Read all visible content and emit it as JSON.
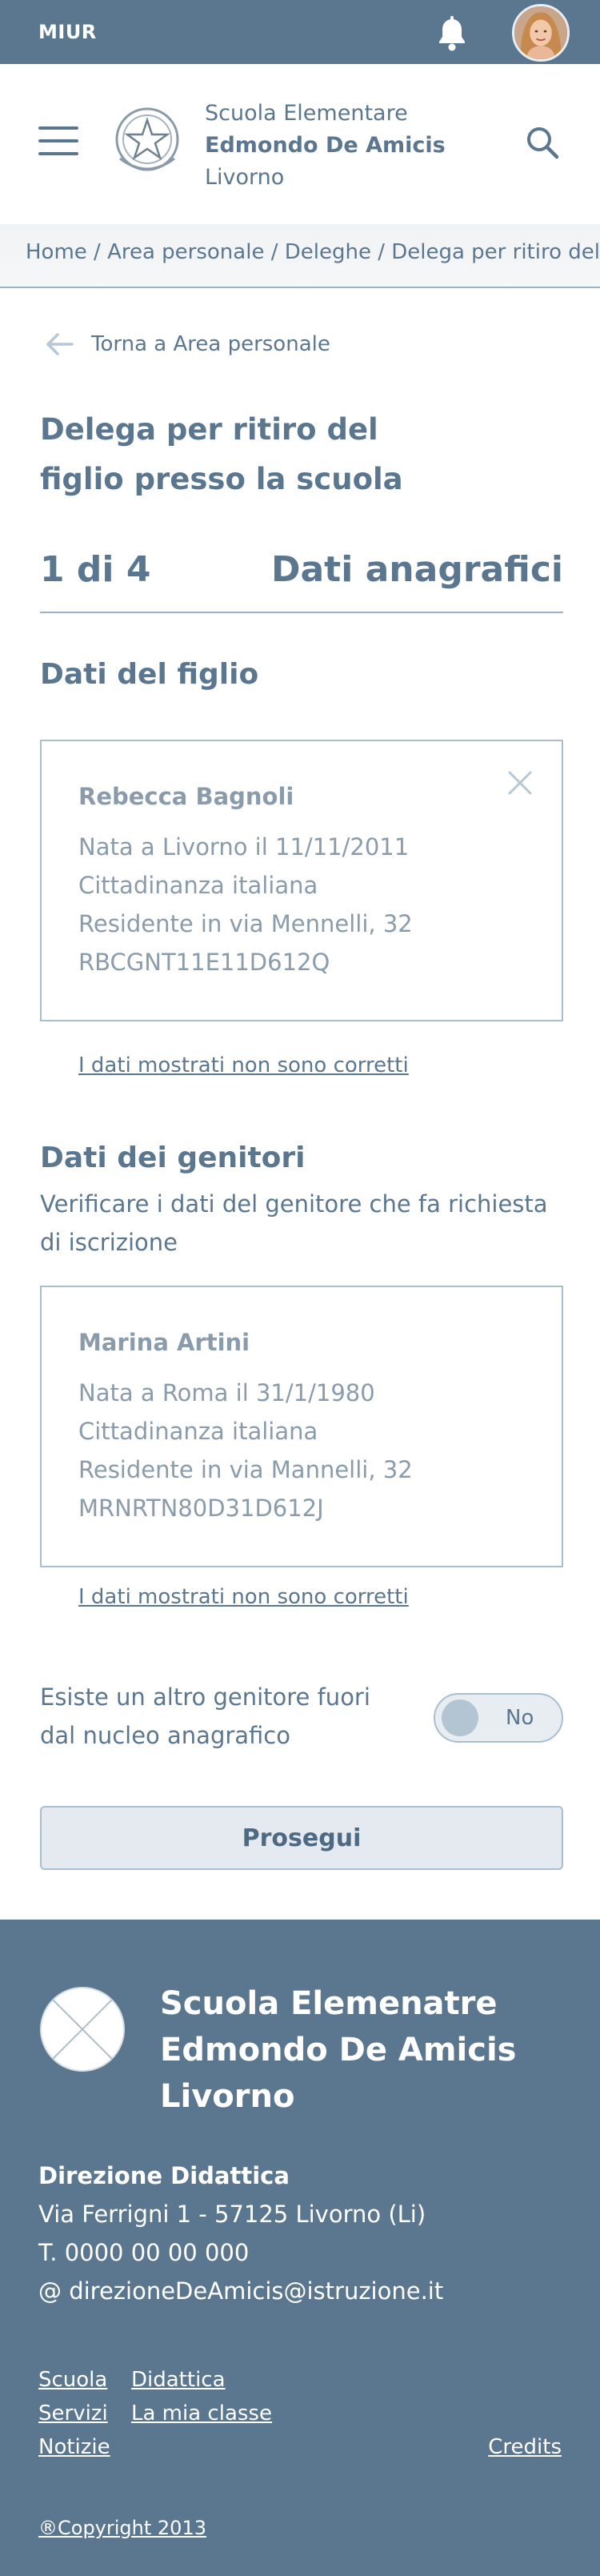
{
  "topbar": {
    "brand": "MIUR",
    "bell_icon": "bell-icon",
    "avatar_icon": "user-avatar"
  },
  "header": {
    "school_line1": "Scuola Elementare",
    "school_line2": "Edmondo De Amicis",
    "school_line3": "Livorno",
    "menu_icon": "hamburger-menu-icon",
    "search_icon": "search-icon"
  },
  "breadcrumb": "Home / Area personale / Deleghe / Delega per ritiro del figlio",
  "back_link": "Torna a Area personale",
  "page_title": "Delega per ritiro del figlio presso la scuola",
  "step": {
    "count": "1 di 4",
    "label": "Dati anagrafici"
  },
  "child_section": {
    "title": "Dati del figlio",
    "card": {
      "name": "Rebecca Bagnoli",
      "line1": "Nata a Livorno il 11/11/2011",
      "line2": "Cittadinanza italiana",
      "line3": "Residente in via Mennelli, 32",
      "line4": "RBCGNT11E11D612Q"
    },
    "wrong_link": "I dati mostrati non sono corretti"
  },
  "parents_section": {
    "title": "Dati dei genitori",
    "subtitle": "Verificare i dati del genitore che fa richiesta di iscrizione",
    "card": {
      "name": "Marina Artini",
      "line1": "Nata a Roma il 31/1/1980",
      "line2": "Cittadinanza italiana",
      "line3": "Residente in via Mannelli, 32",
      "line4": "MRNRTN80D31D612J"
    },
    "wrong_link": "I dati mostrati non sono corretti"
  },
  "other_parent": {
    "label": "Esiste un altro genitore fuori dal nucleo anagrafico",
    "toggle_value": "No"
  },
  "continue_button": "Prosegui",
  "footer": {
    "school_line1": "Scuola Elemenatre",
    "school_line2": "Edmondo De Amicis",
    "school_line3": "Livorno",
    "direction": "Direzione Didattica",
    "address": "Via Ferrigni 1 - 57125 Livorno (Li)",
    "phone": "T. 0000 00 00 000",
    "email": "@ direzioneDeAmicis@istruzione.it",
    "links": {
      "scuola": "Scuola",
      "didattica": "Didattica",
      "servizi": "Servizi",
      "la_mia_classe": "La mia classe",
      "notizie": "Notizie",
      "credits": "Credits"
    },
    "copyright": "®Copyright 2013"
  },
  "colors": {
    "primary": "#5b7790",
    "muted_text": "#8a9cac",
    "border": "#a9bfd1",
    "button_bg": "#e4eaf0"
  }
}
